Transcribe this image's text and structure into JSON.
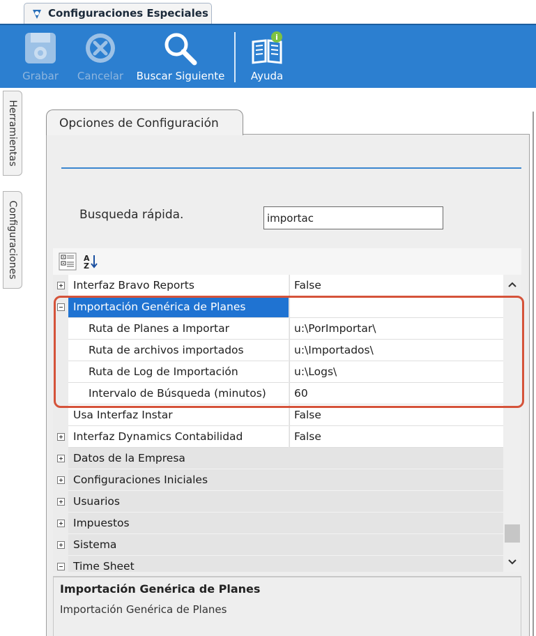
{
  "window": {
    "title": "Configuraciones Especiales"
  },
  "toolbar": {
    "grabar": "Grabar",
    "cancelar": "Cancelar",
    "buscar": "Buscar Siguiente",
    "ayuda": "Ayuda"
  },
  "side_tabs": {
    "herramientas": "Herramientas",
    "configuraciones": "Configuraciones"
  },
  "panel": {
    "tab": "Opciones de Configuración",
    "search_label": "Busqueda rápida.",
    "search_value": "importac"
  },
  "grid": {
    "rows": [
      {
        "name": "Interfaz Bravo Reports",
        "value": "False"
      },
      {
        "name": "Importación Genérica de Planes",
        "value": ""
      },
      {
        "name": "Ruta de Planes a Importar",
        "value": "u:\\PorImportar\\"
      },
      {
        "name": "Ruta de archivos importados",
        "value": "u:\\Importados\\"
      },
      {
        "name": "Ruta de Log de Importación",
        "value": "u:\\Logs\\"
      },
      {
        "name": "Intervalo de Búsqueda (minutos)",
        "value": "60"
      },
      {
        "name": "Usa Interfaz Instar",
        "value": "False"
      },
      {
        "name": "Interfaz Dynamics Contabilidad",
        "value": "False"
      },
      {
        "name": "Datos de la Empresa",
        "value": ""
      },
      {
        "name": "Configuraciones Iniciales",
        "value": ""
      },
      {
        "name": "Usuarios",
        "value": ""
      },
      {
        "name": "Impuestos",
        "value": ""
      },
      {
        "name": "Sistema",
        "value": ""
      },
      {
        "name": "Time Sheet",
        "value": ""
      }
    ]
  },
  "description": {
    "title": "Importación Genérica de Planes",
    "text": "Importación Genérica de Planes"
  },
  "colors": {
    "toolbar": "#2c7fd0",
    "selection": "#1f73d2",
    "highlight_border": "#d5533a"
  }
}
